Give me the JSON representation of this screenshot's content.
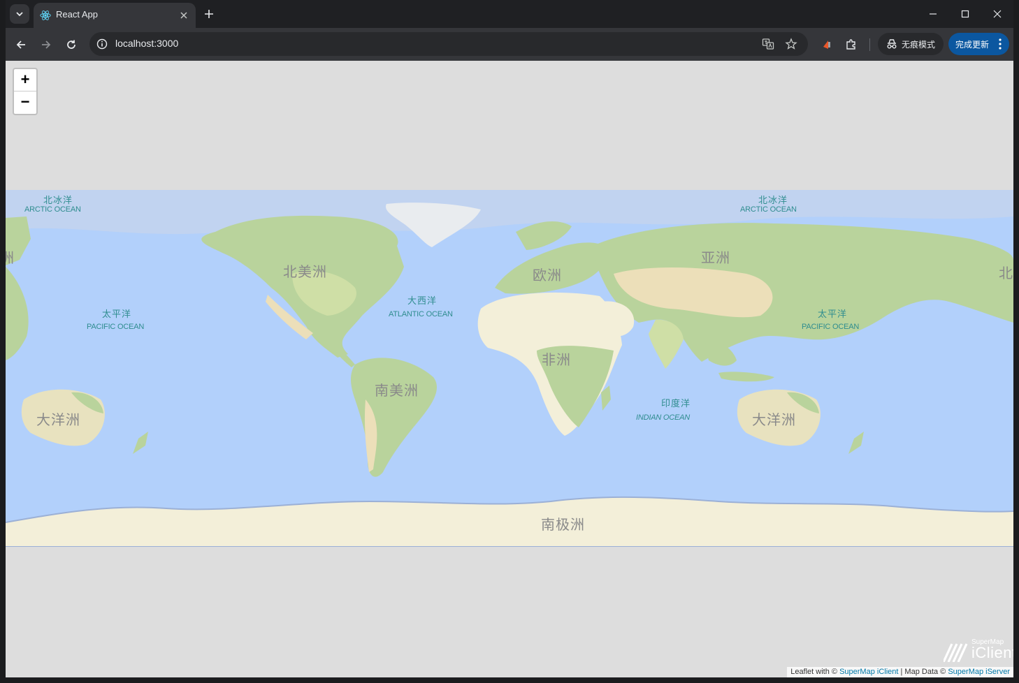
{
  "browser": {
    "tab": {
      "title": "React App"
    },
    "omnibox": {
      "url": "localhost:3000"
    },
    "incognito_label": "无痕模式",
    "update_label": "完成更新"
  },
  "map": {
    "zoom": {
      "in_label": "+",
      "out_label": "−"
    },
    "continents": [
      {
        "name": "北美洲"
      },
      {
        "name": "南美洲"
      },
      {
        "name": "欧洲"
      },
      {
        "name": "非洲"
      },
      {
        "name": "亚洲"
      },
      {
        "name": "大洋洲"
      },
      {
        "name": "南极洲"
      },
      {
        "name": "大洋洲"
      },
      {
        "name": "洲"
      },
      {
        "name": "北"
      }
    ],
    "oceans": [
      {
        "zh": "北冰洋",
        "en": "ARCTIC OCEAN"
      },
      {
        "zh": "北冰洋",
        "en": "ARCTIC OCEAN"
      },
      {
        "zh": "太平洋",
        "en": "PACIFIC OCEAN"
      },
      {
        "zh": "太平洋",
        "en": "PACIFIC OCEAN"
      },
      {
        "zh": "大西洋",
        "en": "ATLANTIC OCEAN"
      },
      {
        "zh": "印度洋",
        "en": "INDIAN OCEAN"
      }
    ],
    "attribution": {
      "prefix": "Leaflet with © ",
      "client_link": "SuperMap iClient",
      "middle": " | Map Data © ",
      "server_link": "SuperMap iServer"
    },
    "logo": {
      "small": "SuperMap",
      "big": "iClient"
    },
    "colors": {
      "ocean": "#b2d0fb",
      "land": "#f3efd9",
      "vegetation": "#b7d39c",
      "background": "#dddddd"
    }
  }
}
